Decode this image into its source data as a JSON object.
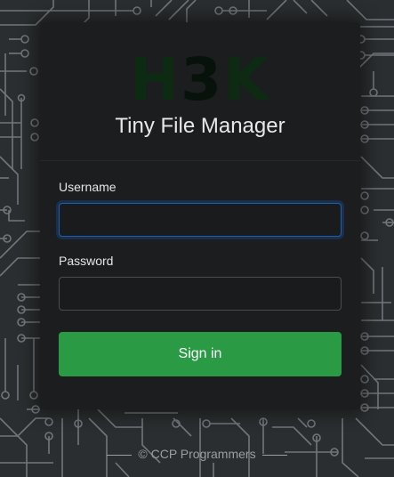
{
  "login": {
    "logo_text_left": "H",
    "logo_text_mid": "3",
    "logo_text_right": "K",
    "title": "Tiny File Manager",
    "username_label": "Username",
    "username_value": "",
    "password_label": "Password",
    "password_value": "",
    "signin_label": "Sign in"
  },
  "footer": {
    "text": "© CCP Programmers"
  },
  "colors": {
    "background": "#2b2e30",
    "card": "#1c1d1f",
    "signin_button": "#2a9a45",
    "focus_ring": "#1f5fa8"
  }
}
